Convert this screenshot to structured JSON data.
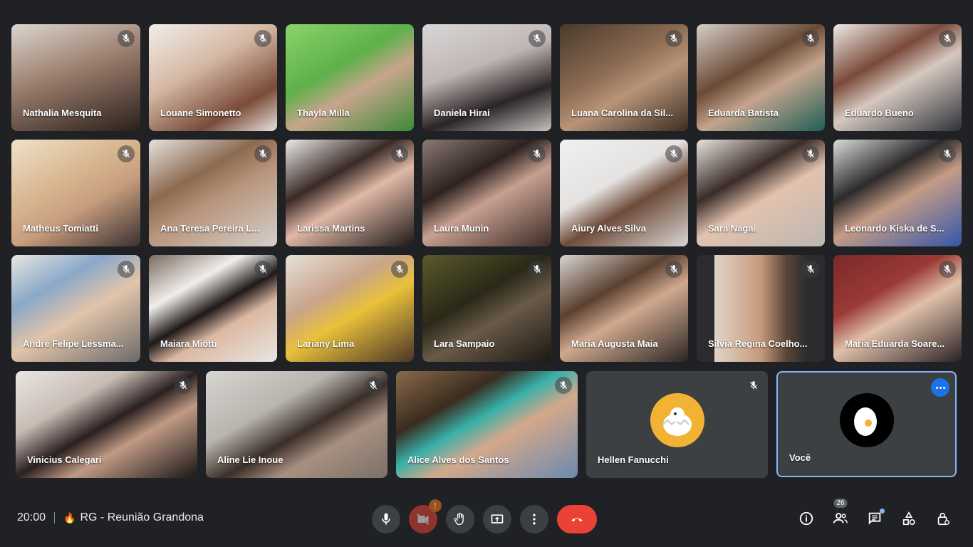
{
  "meeting": {
    "time": "20:00",
    "flame_icon": "🔥",
    "title": "RG - Reunião Grandona",
    "participant_count": "26"
  },
  "tiles": {
    "t1": "Nathalia Mesquita",
    "t2": "Louane Simonetto",
    "t3": "Thayla Milla",
    "t4": "Daniela Hirai",
    "t5": "Luana Carolina da Sil...",
    "t6": "Eduarda Batista",
    "t7": "Eduardo Bueno",
    "t8": "Matheus Tomiatti",
    "t9": "Ana Teresa Pereira L...",
    "t10": "Larissa Martins",
    "t11": "Laura Munin",
    "t12": "Aiury Alves Silva",
    "t13": "Sara Nagai",
    "t14": "Leonardo Kiska de S...",
    "t15": "André Felipe Lessma...",
    "t16": "Maiara Miotti",
    "t17": "Lariany Lima",
    "t18": "Lara Sampaio",
    "t19": "Maria Augusta Maia",
    "t20": "Silvia Regina Coelho...",
    "t21": "Maria Eduarda Soare...",
    "t22": "Vinicius Calegari",
    "t23": "Aline Lie Inoue",
    "t24": "Alice Alves dos Santos",
    "t25": "Hellen Fanucchi",
    "t26": "Você"
  },
  "icons": {
    "mic": "mic-icon",
    "camera_off": "camera-off-icon",
    "raise_hand": "raise-hand-icon",
    "present": "present-screen-icon",
    "more": "more-options-icon",
    "leave": "leave-call-icon",
    "info": "info-icon",
    "people": "people-icon",
    "chat": "chat-icon",
    "activities": "activities-icon",
    "host_controls": "host-controls-icon",
    "muted": "mic-off-icon"
  },
  "colors": {
    "background": "#202124",
    "tile_empty": "#3c4043",
    "leave_red": "#ea4335",
    "self_border": "#8ab4f8",
    "warning": "#fa7b17",
    "menu_blue": "#1a73e8"
  }
}
